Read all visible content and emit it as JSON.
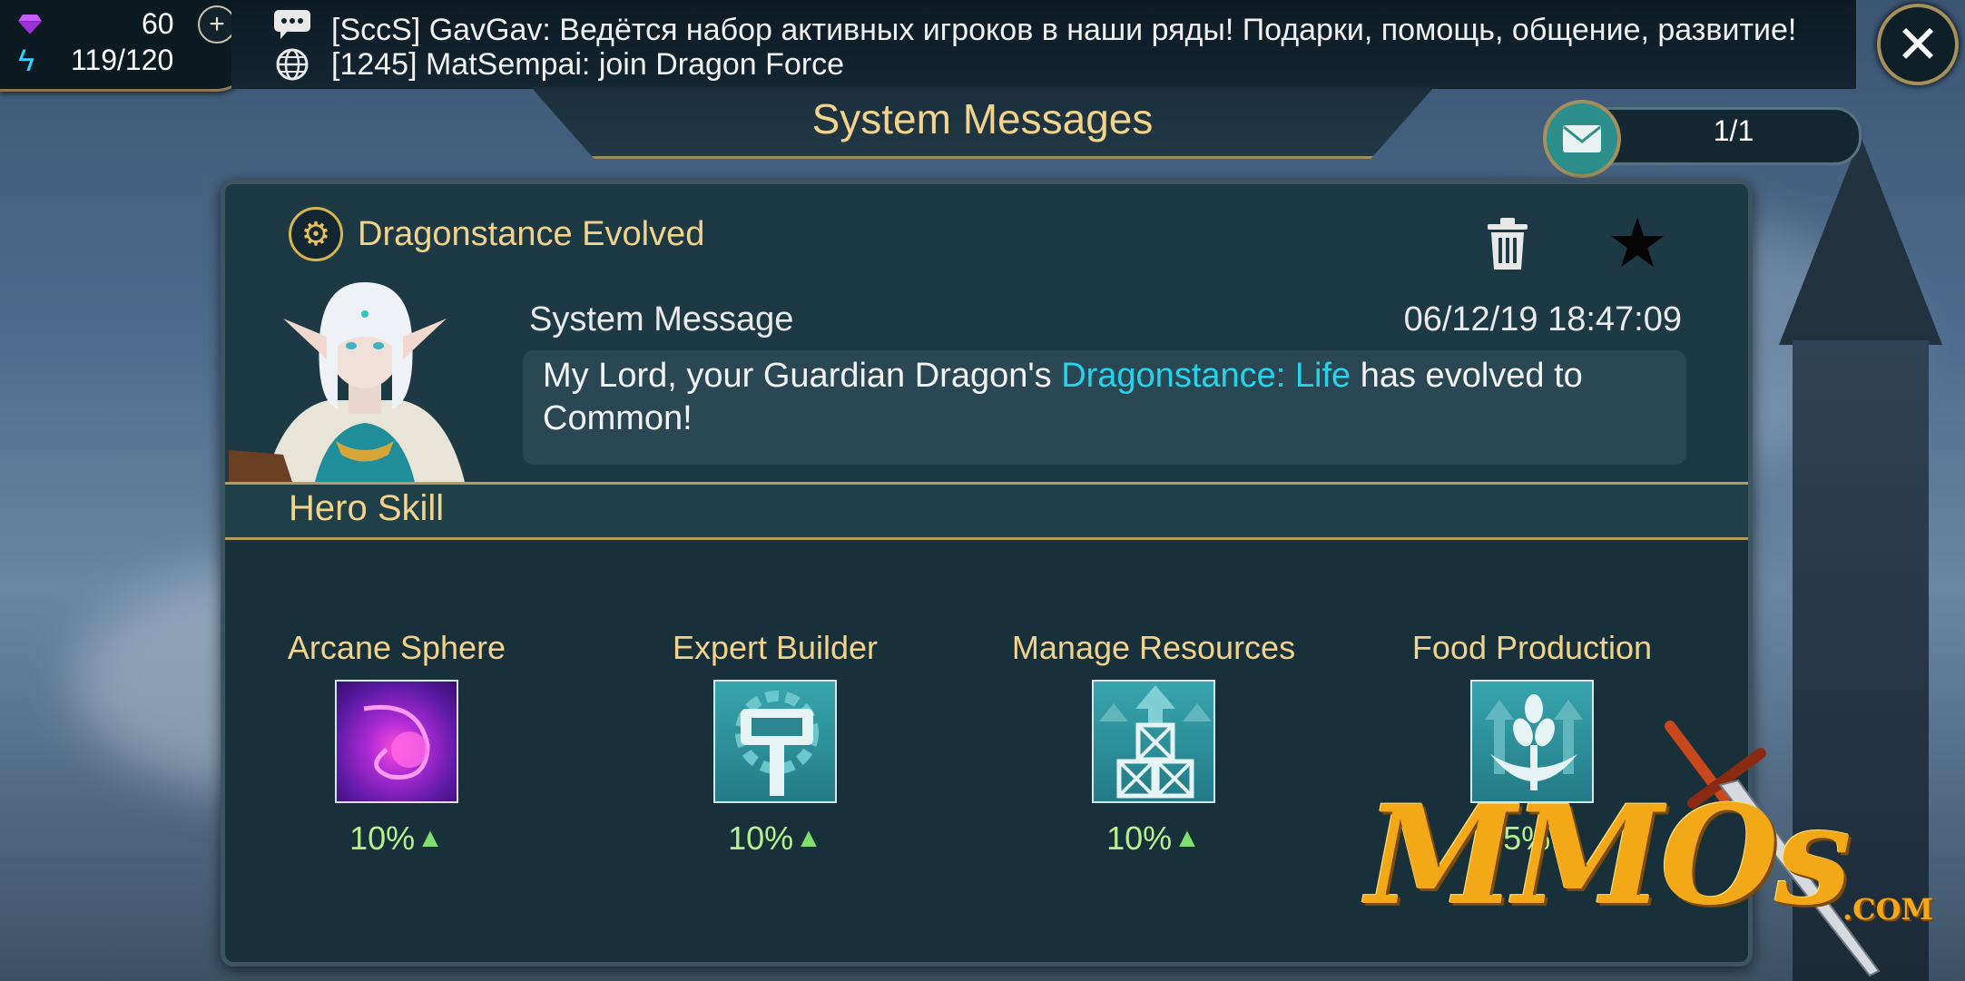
{
  "resources": {
    "gems": "60",
    "energy": "119/120",
    "gem_icon": "gem-icon",
    "energy_icon": "lightning-icon"
  },
  "chat": {
    "line1": "[SccS] GavGav: Ведётся набор активных игроков в наши ряды!  Подарки, помощь, общение, развитие!",
    "line2": "[1245] MatSempai: join Dragon Force"
  },
  "header": {
    "title": "System Messages",
    "counter": "1/1",
    "close_label": "✕"
  },
  "mail": {
    "title": "Dragonstance Evolved",
    "sender": "System Message",
    "timestamp": "06/12/19 18:47:09",
    "body_prefix": "My Lord, your Guardian Dragon's ",
    "body_highlight": "Dragonstance: Life",
    "body_suffix": " has evolved to Common!"
  },
  "skills": {
    "header": "Hero Skill",
    "items": [
      {
        "name": "Arcane Sphere",
        "value": "10%"
      },
      {
        "name": "Expert Builder",
        "value": "10%"
      },
      {
        "name": "Manage Resources",
        "value": "10%"
      },
      {
        "name": "Food Production",
        "value": "25%"
      }
    ]
  },
  "watermark": {
    "text": "MMOs",
    "suffix": ".COM"
  },
  "colors": {
    "gold_text": "#f2d38c",
    "highlight": "#27d3ea",
    "bonus_green": "#b7f08f",
    "panel": "#183039"
  }
}
